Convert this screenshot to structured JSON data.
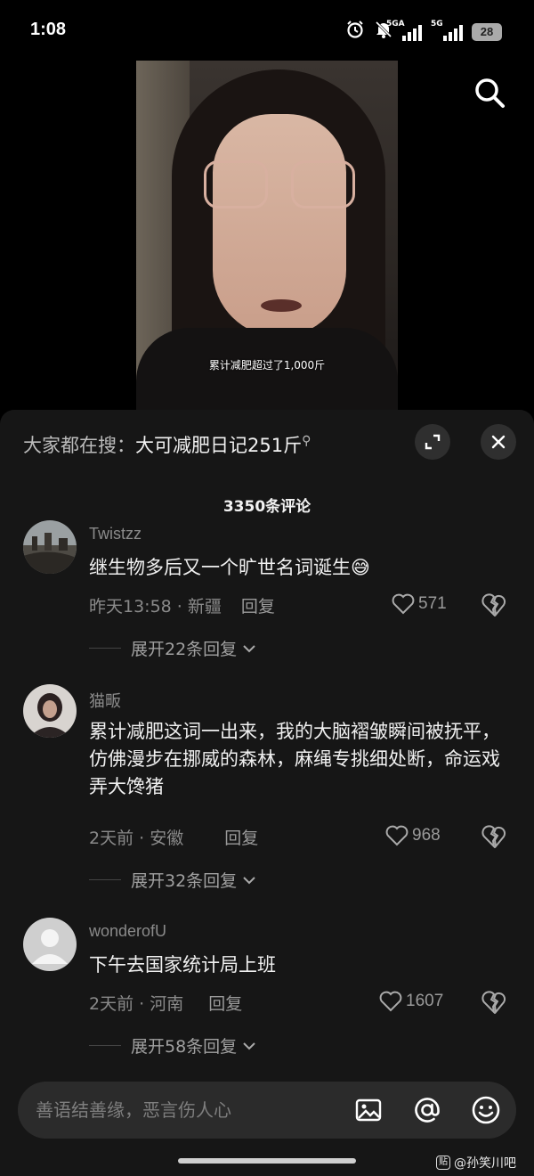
{
  "status_bar": {
    "time": "1:08",
    "network1": "5GA",
    "network2": "5G",
    "battery": "28"
  },
  "video": {
    "caption": "累计减肥超过了1,000斤"
  },
  "search": {
    "icon": "search-icon"
  },
  "sheet": {
    "trending_label": "大家都在搜：",
    "trending_term": "大可减肥日记251斤",
    "comment_count": "3350条评论",
    "input_placeholder": "善语结善缘，恶言伤人心"
  },
  "comments": [
    {
      "username": "Twistzz",
      "text": "继生物多后又一个旷世名词诞生😅",
      "time": "昨天13:58",
      "location": "新疆",
      "reply_label": "回复",
      "likes": "571",
      "expand": "展开22条回复"
    },
    {
      "username": "猫畈",
      "text": "累计减肥这词一出来，我的大脑褶皱瞬间被抚平，仿佛漫步在挪威的森林，麻绳专挑细处断，命运戏弄大馋猪",
      "time": "2天前",
      "location": "安徽",
      "reply_label": "回复",
      "likes": "968",
      "expand": "展开32条回复"
    },
    {
      "username": "wonderofU",
      "text": "下午去国家统计局上班",
      "time": "2天前",
      "location": "河南",
      "reply_label": "回复",
      "likes": "1607",
      "expand": "展开58条回复"
    }
  ],
  "watermark": "@孙笑川吧",
  "colors": {
    "background": "#000000",
    "sheet": "#161616",
    "muted_text": "#8a8a8a",
    "input_bg": "#2b2b2b"
  }
}
